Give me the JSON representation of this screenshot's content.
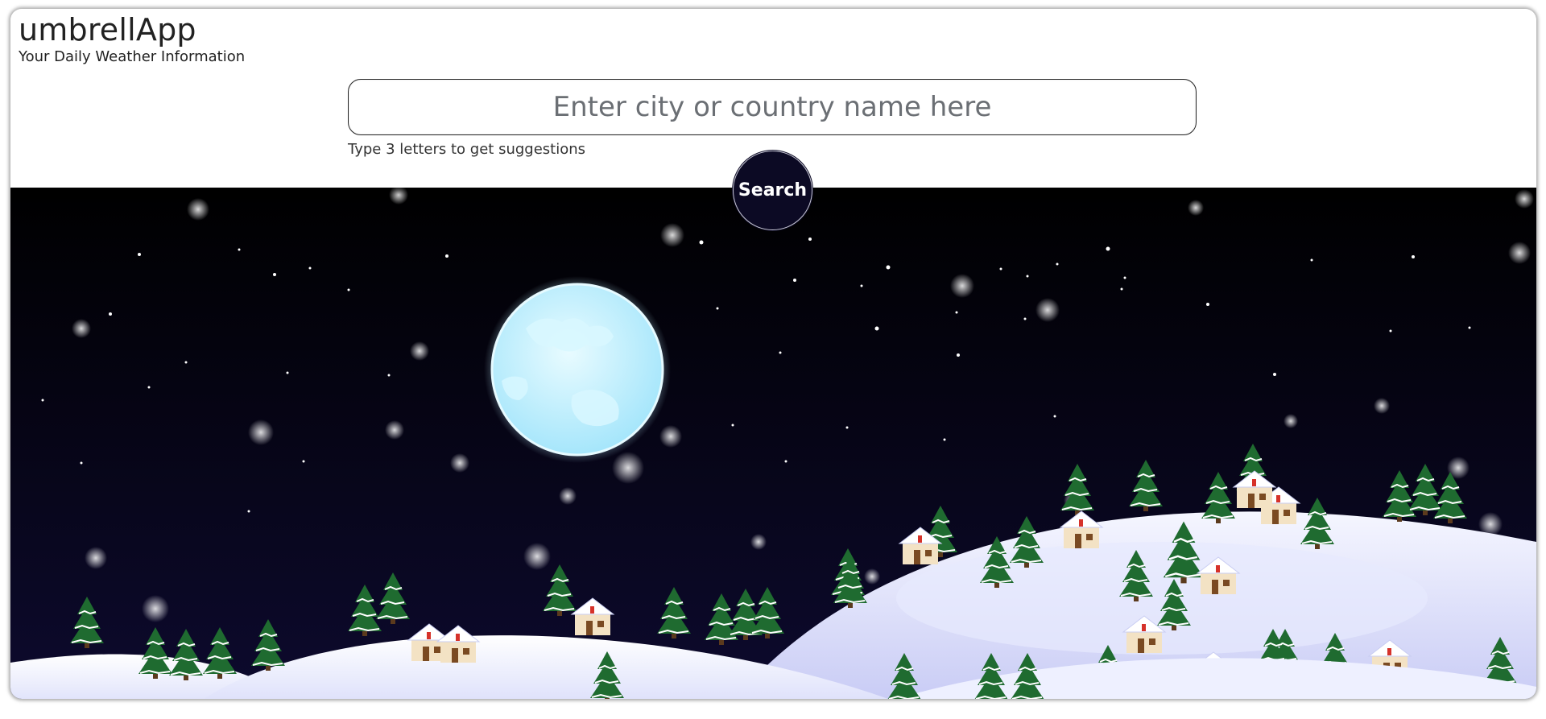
{
  "app": {
    "title": "umbrellApp",
    "tagline": "Your Daily Weather Information"
  },
  "search": {
    "placeholder": "Enter city or country name here",
    "value": "",
    "hint": "Type 3 letters to get suggestions",
    "button_label": "Search"
  },
  "background": {
    "scene": "winter-night",
    "colors": {
      "sky_top": "#000000",
      "sky_bottom": "#0d0a2e",
      "moon": "#c8f1ff",
      "snow": "#eef0ff",
      "tree": "#1f6b30"
    }
  }
}
